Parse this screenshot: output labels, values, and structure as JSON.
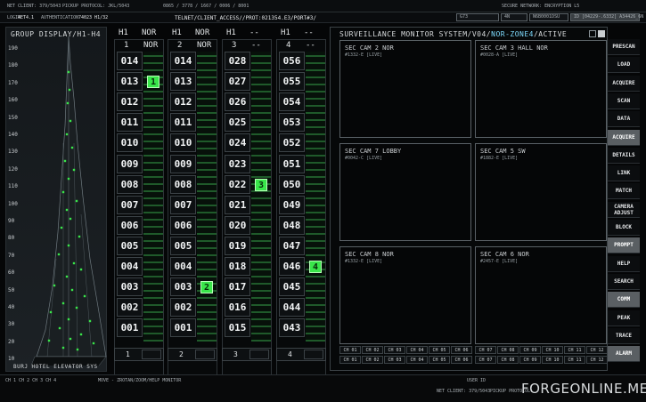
{
  "header": {
    "net_client": "NET CLIENT: 379/5043",
    "pickup_protocol": "PICKUP PROTOCOL: JKL/5043",
    "ids": "0865 / 3778 / 1667 / 0006 / 8001",
    "secure_network": "SECURE NETWORK: ENCRYPTION L5",
    "login_label": "LOGIN",
    "login_value": "4ET4.1",
    "auth_label": "AUTHENTICATION",
    "auth_value": "74023 H1/32",
    "telnet_path": "TELNET/CLIENT_ACCESS//PROT:021354.E3/PORT#3/",
    "status_a": "G73",
    "status_b": "4N",
    "status_c": "N6B0001DSU",
    "status_d": "ID [04229-.6332] A34426_6N"
  },
  "building": {
    "title": "GROUP DISPLAY/H1-H4",
    "caption": "BURJ HOTEL ELEVATOR SYS",
    "floor_ticks": [
      "190",
      "180",
      "170",
      "160",
      "150",
      "140",
      "130",
      "120",
      "110",
      "100",
      "90",
      "80",
      "70",
      "60",
      "50",
      "40",
      "30",
      "20",
      "10"
    ]
  },
  "elevators": [
    {
      "id": "1",
      "mode": "NOR",
      "car": "1",
      "floors": [
        "014",
        "013",
        "012",
        "011",
        "010",
        "009",
        "008",
        "007",
        "006",
        "005",
        "004",
        "003",
        "002",
        "001"
      ],
      "car_floor_index": 1,
      "footer": "1"
    },
    {
      "id": "2",
      "mode": "NOR",
      "car": "2",
      "floors": [
        "014",
        "013",
        "012",
        "011",
        "010",
        "009",
        "008",
        "007",
        "006",
        "005",
        "004",
        "003",
        "002",
        "001"
      ],
      "car_floor_index": 11,
      "footer": "2"
    },
    {
      "id": "3",
      "mode": "--",
      "car": "3",
      "floors": [
        "028",
        "027",
        "026",
        "025",
        "024",
        "023",
        "022",
        "021",
        "020",
        "019",
        "018",
        "017",
        "016",
        "015"
      ],
      "car_floor_index": 6,
      "footer": "3"
    },
    {
      "id": "4",
      "mode": "--",
      "car": "4",
      "floors": [
        "056",
        "055",
        "054",
        "053",
        "052",
        "051",
        "050",
        "049",
        "048",
        "047",
        "046",
        "045",
        "044",
        "043"
      ],
      "car_floor_index": 10,
      "footer": "4"
    }
  ],
  "column_prefix": "H1",
  "monitor": {
    "title_a": "SURVEILLANCE MONITOR SYSTEM/V04/",
    "title_b": "NOR-ZONE4",
    "title_c": "/ACTIVE",
    "cams": [
      {
        "title": "SEC CAM 2 NOR",
        "sub": "#1332-E [LIVE]"
      },
      {
        "title": "SEC CAM 3 HALL NOR",
        "sub": "#0028-A [LIVE]"
      },
      {
        "title": "SEC CAM 7 LOBBY",
        "sub": "#0042-C [LIVE]"
      },
      {
        "title": "SEC CAM 5 SW",
        "sub": "#1882-E [LIVE]"
      },
      {
        "title": "SEC CAM 8 NOR",
        "sub": "#1332-E [LIVE]"
      },
      {
        "title": "SEC CAM 6 NOR",
        "sub": "#2457-E [LIVE]"
      }
    ],
    "channels_row1": [
      "CH 01",
      "CH 02",
      "CH 03",
      "CH 04",
      "CH 05",
      "CH 06",
      "CH 07",
      "CH 08",
      "CH 09",
      "CH 10",
      "CH 11",
      "CH 12"
    ],
    "channels_row2": [
      "CH 01",
      "CH 02",
      "CH 03",
      "CH 04",
      "CH 05",
      "CH 06",
      "CH 07",
      "CH 08",
      "CH 09",
      "CH 10",
      "CH 11",
      "CH 12"
    ]
  },
  "menu": [
    {
      "label": "PRESCAN",
      "hl": false
    },
    {
      "label": "LOAD",
      "hl": false
    },
    {
      "label": "ACQUIRE",
      "hl": false
    },
    {
      "label": "SCAN",
      "hl": false
    },
    {
      "label": "DATA",
      "hl": false
    },
    {
      "label": "ACQUIRE",
      "hl": true
    },
    {
      "label": "DETAILS",
      "hl": false
    },
    {
      "label": "LINK",
      "hl": false
    },
    {
      "label": "MATCH",
      "hl": false
    },
    {
      "label": "CAMERA ADJUST",
      "hl": false
    },
    {
      "label": "BLOCK",
      "hl": false
    },
    {
      "label": "PROMPT",
      "hl": true
    },
    {
      "label": "HELP",
      "hl": false
    },
    {
      "label": "SEARCH",
      "hl": false
    },
    {
      "label": "COMM",
      "hl": true
    },
    {
      "label": "PEAK",
      "hl": false
    },
    {
      "label": "TRACE",
      "hl": false
    },
    {
      "label": "ALARM",
      "hl": true
    }
  ],
  "footer": {
    "left_codes": "CH 1  CH 2  CH 3  CH 4",
    "mid_text": "MOVE - ZROTAN/ZOOM/HELP MONITOR",
    "net_client": "NET CLIENT: 379/5043",
    "pickup": "PICKUP PROTOCOL:",
    "watermark": "FORGEONLINE.ME",
    "user_id": "USER ID"
  },
  "colors": {
    "accent_green": "#39e64a",
    "monitor_highlight": "#7fdcff"
  }
}
